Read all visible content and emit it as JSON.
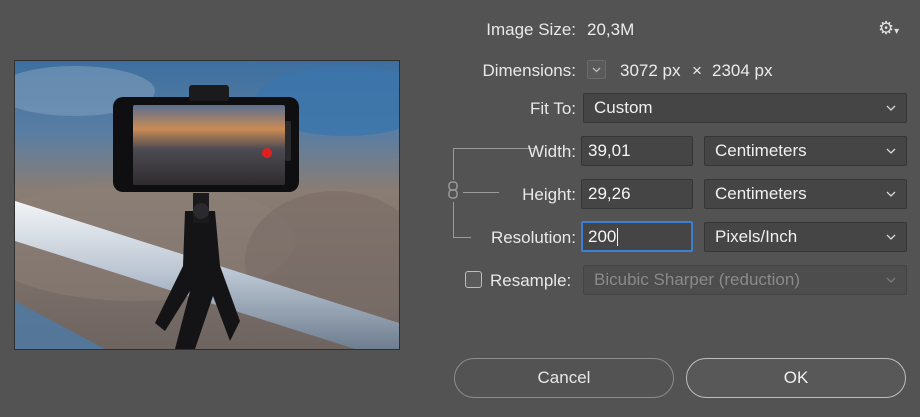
{
  "preview": {
    "alt": "Smartphone on a tripod mount"
  },
  "image_size": {
    "label": "Image Size:",
    "value": "20,3M"
  },
  "dimensions": {
    "label": "Dimensions:",
    "width": "3072 px",
    "times": "×",
    "height": "2304 px"
  },
  "fit_to": {
    "label": "Fit To:",
    "value": "Custom"
  },
  "width": {
    "label": "Width:",
    "value": "39,01",
    "unit": "Centimeters"
  },
  "height": {
    "label": "Height:",
    "value": "29,26",
    "unit": "Centimeters"
  },
  "resolution": {
    "label": "Resolution:",
    "value": "200",
    "unit": "Pixels/Inch"
  },
  "resample": {
    "label": "Resample:",
    "checked": false,
    "method": "Bicubic Sharper (reduction)"
  },
  "buttons": {
    "cancel": "Cancel",
    "ok": "OK"
  },
  "icons": {
    "settings": "gear-icon",
    "link": "chain-link-icon"
  },
  "colors": {
    "background": "#535353",
    "focus": "#3b7fd6"
  }
}
